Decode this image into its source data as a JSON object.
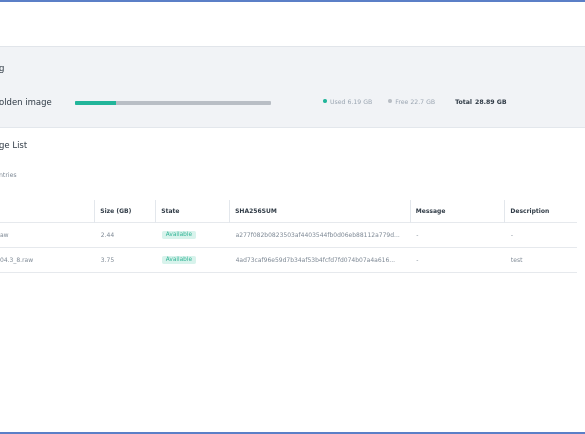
{
  "storage": {
    "title": "g",
    "golden_label": "olden image",
    "used_fraction": 0.207,
    "used_label": "Used",
    "used_value": "6.19 GB",
    "free_label": "Free",
    "free_value": "22.7 GB",
    "total_label": "Total",
    "total_value": "28.89 GB",
    "colors": {
      "used": "#22b59a",
      "free": "#b9bec5"
    }
  },
  "list": {
    "title": "ge List",
    "entries_text": "ntries",
    "columns": [
      "",
      "Size (GB)",
      "State",
      "SHA256SUM",
      "Message",
      "Description"
    ],
    "rows": [
      {
        "name": "aw",
        "size": "2.44",
        "state": "Available",
        "sha": "a277f082b0823503af4403544fb0d06eb88112a779d...",
        "message": "-",
        "description": "-"
      },
      {
        "name": "04.3_8.raw",
        "size": "3.75",
        "state": "Available",
        "sha": "4ad73caf96e59d7b34af53b4fcfd7fd074b07a4a616...",
        "message": "-",
        "description": "test"
      }
    ]
  }
}
